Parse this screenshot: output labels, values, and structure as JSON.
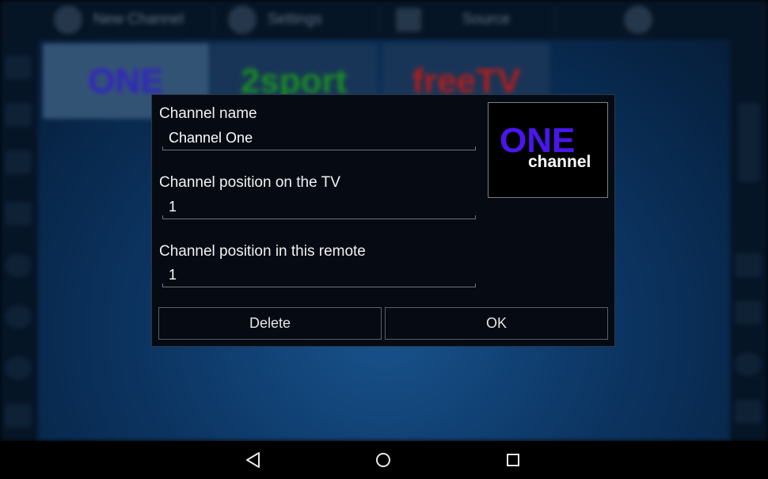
{
  "background_app": {
    "topbar": {
      "new_channel_label": "New Channel",
      "settings_label": "Settings",
      "source_label": "Source"
    },
    "tiles": [
      {
        "label": "ONE"
      },
      {
        "label": "2sport"
      },
      {
        "label": "freeTV"
      }
    ]
  },
  "dialog": {
    "channel_name_label": "Channel name",
    "channel_name_value": "Channel One",
    "tv_position_label": "Channel position on the TV",
    "tv_position_value": "1",
    "remote_position_label": "Channel position in this remote",
    "remote_position_value": "1",
    "logo": {
      "line1": "ONE",
      "line2": "channel",
      "color_line1": "#4a16ee",
      "color_line2": "#ffffff"
    },
    "delete_label": "Delete",
    "ok_label": "OK"
  },
  "navbar": {
    "back_icon": "back-triangle-icon",
    "home_icon": "home-circle-icon",
    "recent_icon": "recent-apps-square-icon"
  },
  "colors": {
    "dialog_bg": "#050a13",
    "accent_bg": "#1c5fa0"
  }
}
